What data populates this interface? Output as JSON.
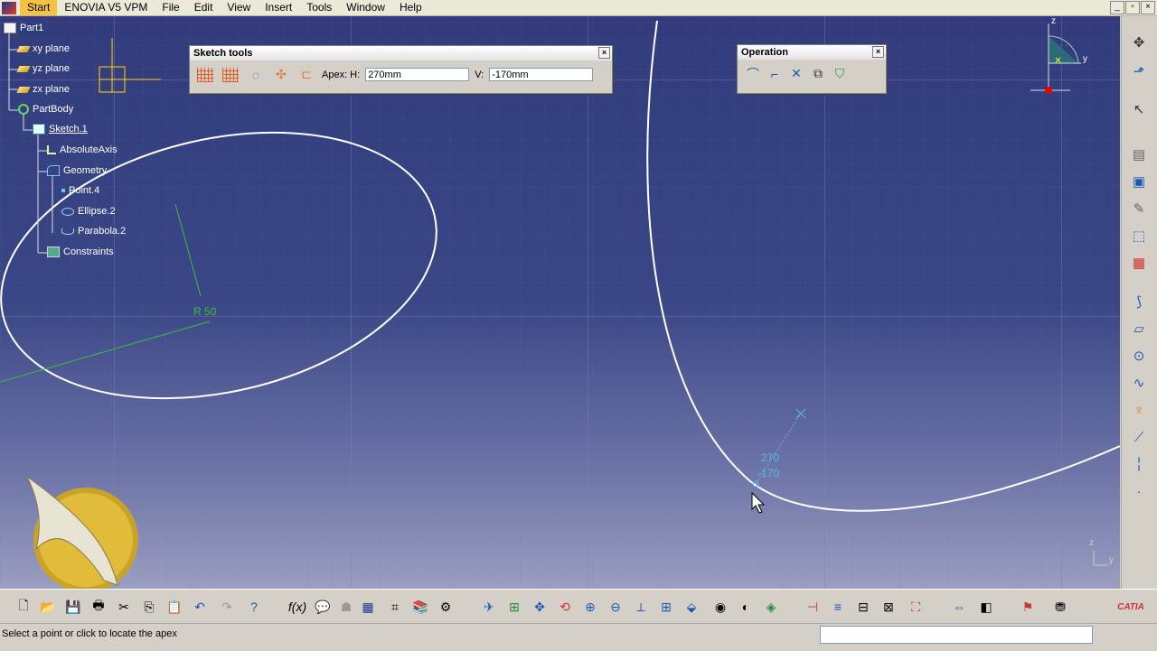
{
  "menu": {
    "items": [
      "Start",
      "ENOVIA V5 VPM",
      "File",
      "Edit",
      "View",
      "Insert",
      "Tools",
      "Window",
      "Help"
    ]
  },
  "window_controls": [
    "_",
    "▫",
    "×"
  ],
  "tree": {
    "root": "Part1",
    "nodes": [
      {
        "label": "xy plane",
        "icon": "plane-icon"
      },
      {
        "label": "yz plane",
        "icon": "plane-icon"
      },
      {
        "label": "zx plane",
        "icon": "plane-icon"
      },
      {
        "label": "PartBody",
        "icon": "gear-icon"
      },
      {
        "label": "Sketch.1",
        "icon": "sketch-icon"
      },
      {
        "label": "AbsoluteAxis",
        "icon": "axis-icon"
      },
      {
        "label": "Geometry",
        "icon": "geometry-icon"
      },
      {
        "label": "Point.4",
        "icon": "point-icon"
      },
      {
        "label": "Ellipse.2",
        "icon": "ellipse-icon"
      },
      {
        "label": "Parabola.2",
        "icon": "parabola-icon"
      },
      {
        "label": "Constraints",
        "icon": "constraints-icon"
      }
    ]
  },
  "sketch_tools": {
    "title": "Sketch tools",
    "apex_label": "Apex: H:",
    "h_value": "270mm",
    "v_label": "V:",
    "v_value": "-170mm",
    "icons": [
      "grid-icon",
      "snap-grid-icon",
      "construction-icon",
      "cst-detection-icon",
      "dimensional-cst-icon"
    ]
  },
  "operation": {
    "title": "Operation",
    "icons": [
      "corner-icon",
      "chamfer-icon",
      "trim-icon",
      "mirror-icon",
      "project-3d-icon"
    ]
  },
  "canvas": {
    "ellipse_dim": "R 50",
    "apex_h": "270",
    "apex_v": "-170",
    "compass_z": "z",
    "compass_y": "y",
    "compass_x": "x",
    "axis_corner_z": "z",
    "axis_corner_y": "y"
  },
  "status": {
    "message": "Select a point or click to locate the apex"
  },
  "colors": {
    "background": "#323c7c",
    "curve": "#ffffff",
    "dimension_green": "#38c038",
    "preview_cyan": "#5ab8e8"
  },
  "brand": "CATIA"
}
